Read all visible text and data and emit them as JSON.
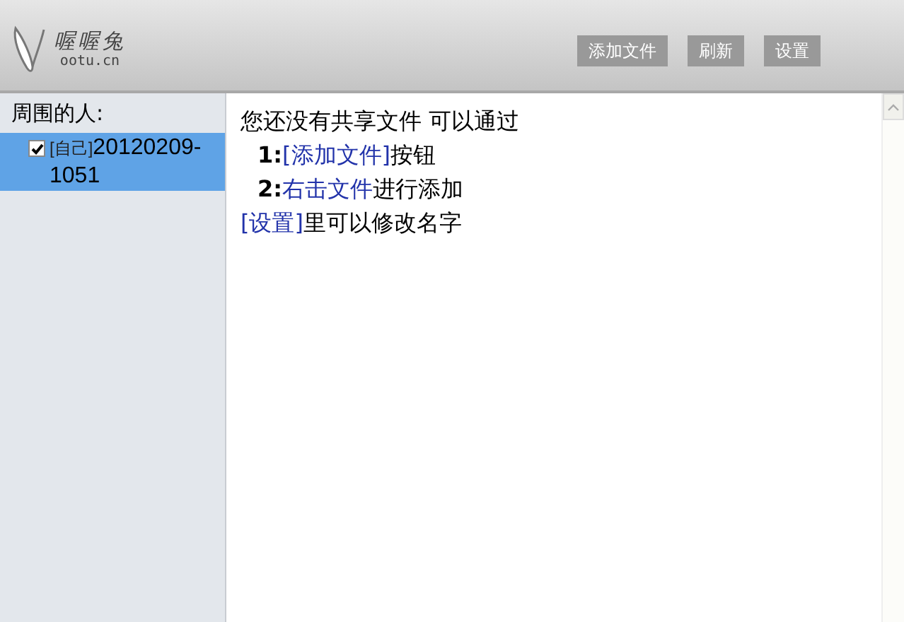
{
  "header": {
    "logo_title": "喔喔兔",
    "logo_subtitle": "ootu.cn",
    "buttons": [
      "添加文件",
      "刷新",
      "设置"
    ]
  },
  "sidebar": {
    "title": "周围的人:",
    "items": [
      {
        "tag": "[自己]",
        "name": "20120209-1051",
        "checked": true,
        "selected": true
      }
    ]
  },
  "content": {
    "lines": [
      {
        "indent": false,
        "segments": [
          {
            "kind": "text",
            "text": "您还没有共享文件  可以通过"
          }
        ]
      },
      {
        "indent": true,
        "segments": [
          {
            "kind": "number",
            "text": "1:"
          },
          {
            "kind": "link",
            "text": "[添加文件]"
          },
          {
            "kind": "text",
            "text": "按钮"
          }
        ]
      },
      {
        "indent": true,
        "segments": [
          {
            "kind": "number",
            "text": "2:"
          },
          {
            "kind": "link",
            "text": "右击文件"
          },
          {
            "kind": "text",
            "text": "进行添加"
          }
        ]
      },
      {
        "indent": false,
        "segments": [
          {
            "kind": "link",
            "text": "[设置]"
          },
          {
            "kind": "text",
            "text": "里可以修改名字"
          }
        ]
      }
    ]
  }
}
